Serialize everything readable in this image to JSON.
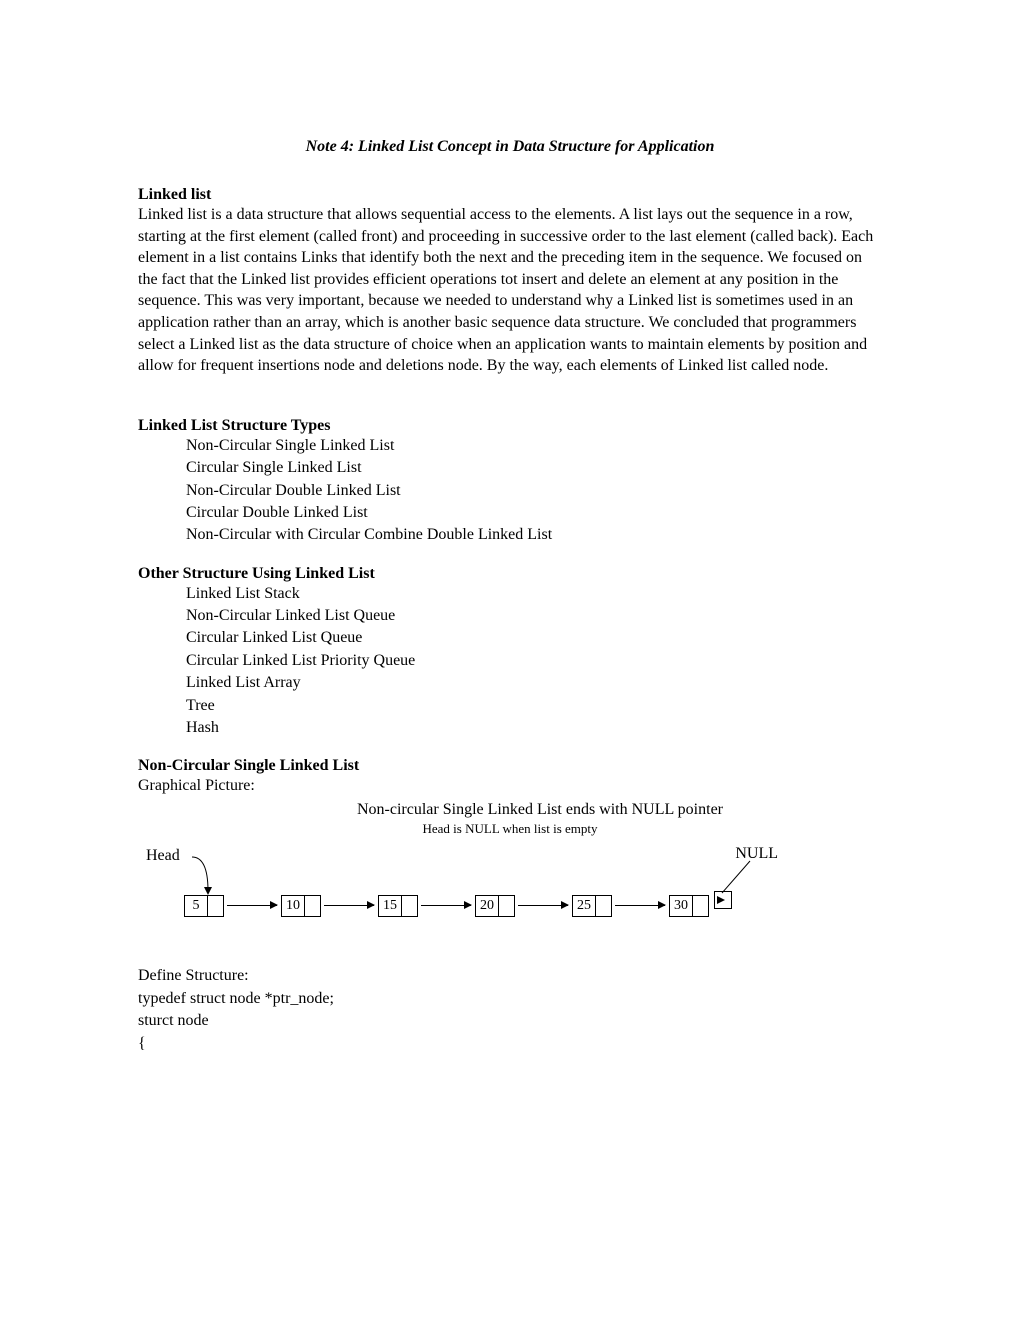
{
  "title": "Note 4: Linked List Concept in Data Structure for Application",
  "s1": {
    "heading": "Linked list",
    "body": "Linked list is a data structure that allows sequential access to the elements.  A list lays out the sequence in a row, starting at the first element (called front) and proceeding in successive order to the last element (called back).  Each element in a list contains Links that identify both the next and the preceding item in the sequence.  We focused on the fact that the Linked list provides efficient operations tot insert and delete an element at any position in the sequence.  This was very important, because we needed to understand why a Linked list is sometimes used in an application rather than an array, which is another basic sequence data structure.  We concluded that programmers select a Linked list as the data structure of choice when an application wants to maintain elements by position and allow for frequent insertions node and deletions node.  By the way, each elements of Linked list called node."
  },
  "s2": {
    "heading": "Linked List Structure Types",
    "items": [
      "Non-Circular Single Linked List",
      "Circular Single Linked List",
      "Non-Circular Double Linked List",
      "Circular Double Linked List",
      "Non-Circular with Circular Combine Double Linked List"
    ]
  },
  "s3": {
    "heading": "Other Structure Using Linked List",
    "items": [
      "Linked List Stack",
      "Non-Circular Linked List Queue",
      "Circular Linked List Queue",
      "Circular Linked List Priority Queue",
      "Linked List Array",
      "Tree",
      "Hash"
    ]
  },
  "s4": {
    "heading": "Non-Circular Single Linked List",
    "sub": "Graphical Picture:",
    "caption": "Non-circular Single Linked List ends with NULL pointer",
    "subcaption": "Head is NULL when list is empty",
    "head_label": "Head",
    "null_label": "NULL",
    "nodes": [
      "5",
      "10",
      "15",
      "20",
      "25",
      "30"
    ]
  },
  "code": {
    "l1": "Define Structure:",
    "l2": "typedef struct node  *ptr_node;",
    "l3": "sturct  node",
    "l4": "{"
  }
}
